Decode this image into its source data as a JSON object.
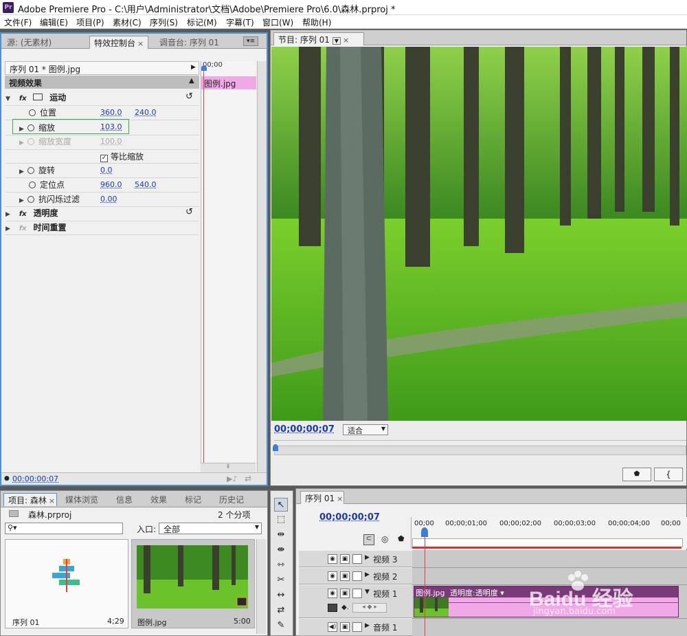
{
  "window": {
    "logo": "Pr",
    "title": "Adobe Premiere Pro - C:\\用户\\Administrator\\文档\\Adobe\\Premiere Pro\\6.0\\森林.prproj *"
  },
  "menu": [
    "文件(F)",
    "编辑(E)",
    "项目(P)",
    "素材(C)",
    "序列(S)",
    "标记(M)",
    "字幕(T)",
    "窗口(W)",
    "帮助(H)"
  ],
  "source_panel": {
    "tabs": [
      "源: (无素材)",
      "特效控制台",
      "调音台: 序列 01"
    ],
    "clip_header": "序列 01 * 图例.jpg",
    "timeline_time": "00;00",
    "clip_bar_label": "图例.jpg",
    "video_effects_label": "视频效果",
    "motion_label": "运动",
    "params": [
      {
        "name": "位置",
        "v1": "360.0",
        "v2": "240.0"
      },
      {
        "name": "缩放",
        "v1": "103.0",
        "v2": ""
      },
      {
        "name": "缩放宽度",
        "v1": "100.0",
        "v2": ""
      },
      {
        "name": "旋转",
        "v1": "0.0",
        "v2": ""
      },
      {
        "name": "定位点",
        "v1": "960.0",
        "v2": "540.0"
      },
      {
        "name": "抗闪烁过滤",
        "v1": "0.00",
        "v2": ""
      }
    ],
    "uniform_scale_label": "等比缩放",
    "opacity_label": "透明度",
    "time_remap_label": "时间重置",
    "current_time": "00:00:00:07"
  },
  "program_monitor": {
    "tab_label": "节目: 序列 01",
    "timecode": "00;00;00;07",
    "fit_label": "适合"
  },
  "project_panel": {
    "tabs": [
      "项目: 森林",
      "媒体浏览",
      "信息",
      "效果",
      "标记",
      "历史记"
    ],
    "project_file": "森林.prproj",
    "item_count": "2 个分项",
    "in_point_label": "入口:",
    "in_point_value": "全部",
    "items": [
      {
        "name": "序列 01",
        "duration": "4;29"
      },
      {
        "name": "图例.jpg",
        "duration": "5:00"
      }
    ]
  },
  "timeline": {
    "tab_label": "序列 01",
    "timecode": "00;00;00;07",
    "ruler": [
      "00;00",
      "00;00;01;00",
      "00;00;02;00",
      "00;00;03;00",
      "00;00;04;00",
      "00;00"
    ],
    "tracks": [
      {
        "name": "视频 3"
      },
      {
        "name": "视频 2"
      },
      {
        "name": "视频 1"
      },
      {
        "name": "音频 1"
      }
    ],
    "clip_label": "图例.jpg",
    "clip_opacity_label": "透明度:透明度 ▾"
  },
  "watermark": {
    "brand": "Baidu 经验",
    "url": "jingyan.baidu.com"
  },
  "colors": {
    "accent_blue": "#1a3ab5",
    "clip_pink": "#f0a8e6",
    "playhead": "#e04040"
  }
}
